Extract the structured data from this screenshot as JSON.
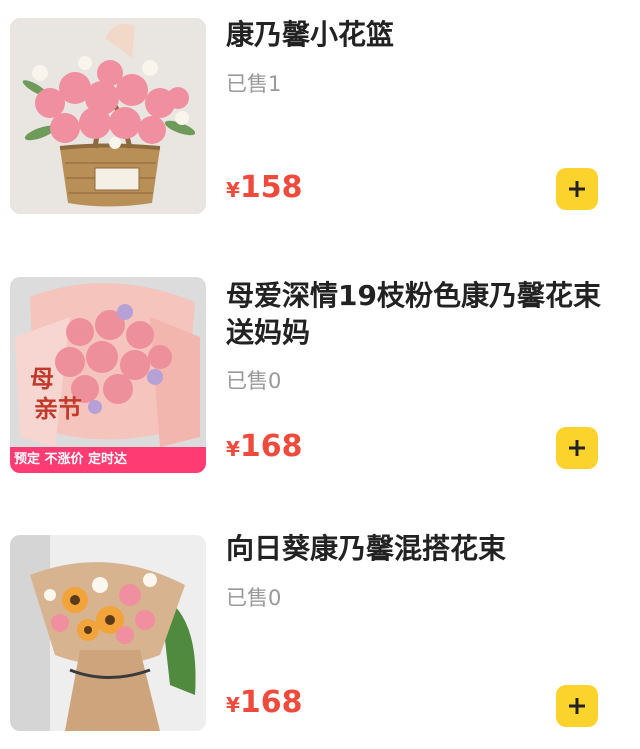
{
  "products": [
    {
      "title": "康乃馨小花篮",
      "sold": "已售1",
      "currency": "¥",
      "price": "158",
      "image": "pink-carnation-basket"
    },
    {
      "title": "母爱深情19枝粉色康乃馨花束送妈妈",
      "sold": "已售0",
      "currency": "¥",
      "price": "168",
      "image": "pink-carnation-bouquet",
      "image_banner": "预定 不涨价 定时达"
    },
    {
      "title": "向日葵康乃馨混搭花束",
      "sold": "已售0",
      "currency": "¥",
      "price": "168",
      "image": "sunflower-carnation-bouquet"
    }
  ],
  "colors": {
    "price": "#ef4b3d",
    "add_button": "#fcd22d",
    "title": "#222222",
    "sold": "#999999"
  },
  "icons": [
    "plus-icon"
  ]
}
